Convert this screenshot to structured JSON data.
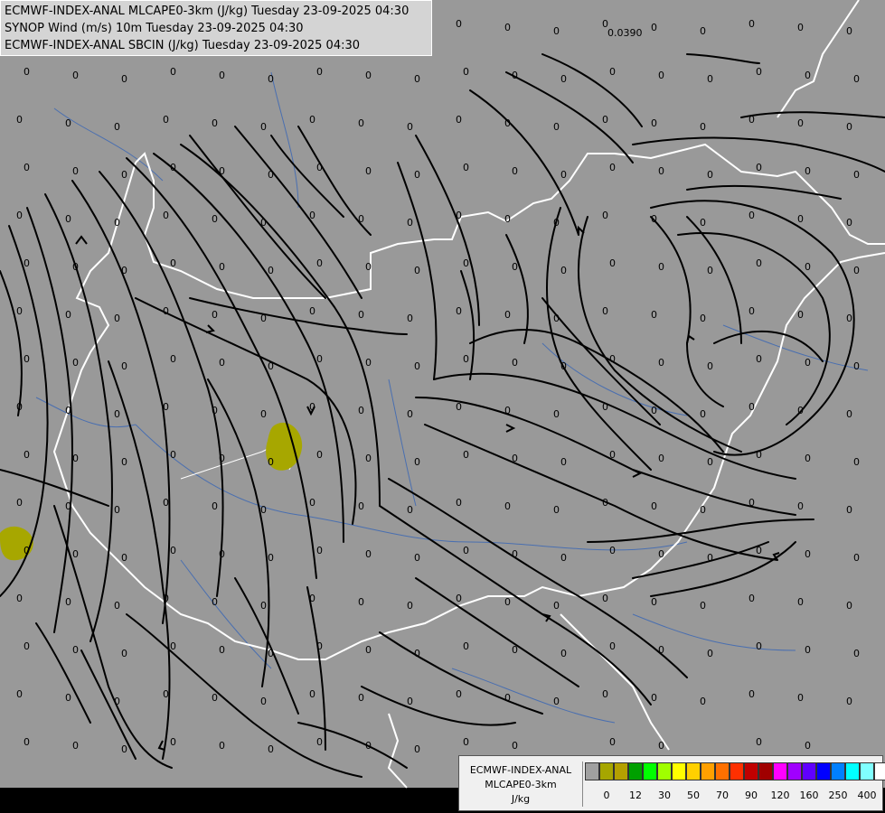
{
  "header": {
    "line1": "ECMWF-INDEX-ANAL MLCAPE0-3km (J/kg) Tuesday 23-09-2025 04:30",
    "line2": "SYNOP Wind (m/s) 10m Tuesday 23-09-2025 04:30",
    "line3": "ECMWF-INDEX-ANAL SBCIN (J/kg) Tuesday 23-09-2025 04:30"
  },
  "legend": {
    "title1": "ECMWF-INDEX-ANAL",
    "title2": "MLCAPE0-3km",
    "unit": "J/kg",
    "colors": [
      "#a0a0a0",
      "#a6a600",
      "#b4a000",
      "#00a000",
      "#00ff00",
      "#a0ff00",
      "#ffff00",
      "#ffd000",
      "#ffa000",
      "#ff7000",
      "#ff3000",
      "#c00000",
      "#a00000",
      "#ff00ff",
      "#a000ff",
      "#6000ff",
      "#0000ff",
      "#0080ff",
      "#00ffff",
      "#80ffff",
      "#ffffff"
    ],
    "ticks": [
      "0",
      "12",
      "30",
      "50",
      "70",
      "90",
      "120",
      "160",
      "250",
      "400"
    ]
  },
  "map": {
    "background": "#999999",
    "streamline_color": "#000000",
    "border_color": "#ffffff",
    "river_color": "#4a6fb0",
    "cape_blob_color": "#a7a700",
    "values": [
      "0",
      "0.0390"
    ]
  }
}
